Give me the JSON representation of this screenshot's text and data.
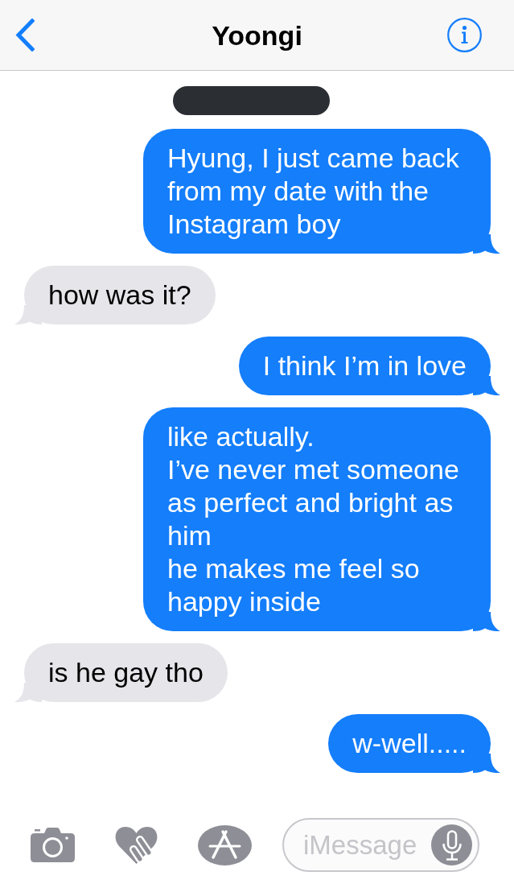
{
  "header": {
    "title": "Yoongi"
  },
  "messages": [
    {
      "kind": "sent",
      "text": "Hyung, I just came back from my date with the Instagram boy"
    },
    {
      "kind": "received",
      "text": "how was it?"
    },
    {
      "kind": "sent",
      "text": "I think I’m in love"
    },
    {
      "kind": "sent",
      "text": "like actually.\nI’ve never met someone as perfect and bright as him\nhe makes me feel so happy inside"
    },
    {
      "kind": "received",
      "text": "is he gay tho"
    },
    {
      "kind": "sent",
      "text": "w-well....."
    }
  ],
  "composer": {
    "placeholder": "iMessage"
  }
}
